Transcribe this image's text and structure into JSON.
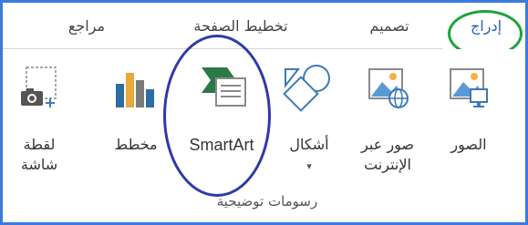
{
  "tabs": [
    {
      "label": "إدراج",
      "active": true
    },
    {
      "label": "تصميم",
      "active": false
    },
    {
      "label": "تخطيط الصفحة",
      "active": false
    },
    {
      "label": "مراجع",
      "active": false
    }
  ],
  "commands": {
    "pictures": "الصور",
    "online_pictures": "صور عبر\nالإنترنت",
    "shapes": "أشكال",
    "shapes_dropdown": "▾",
    "smartart": "SmartArt",
    "chart": "مخطط",
    "screenshot": "لقطة\nشاشة"
  },
  "group": {
    "label": "رسومات توضيحية"
  },
  "colors": {
    "frame_border": "#3a7be0",
    "active_tab_text": "#2a61b5",
    "green_annotation": "#1ea33a",
    "blue_annotation": "#2f3aa8",
    "icon_blue": "#3a7ab8",
    "icon_green": "#2a7a48"
  }
}
